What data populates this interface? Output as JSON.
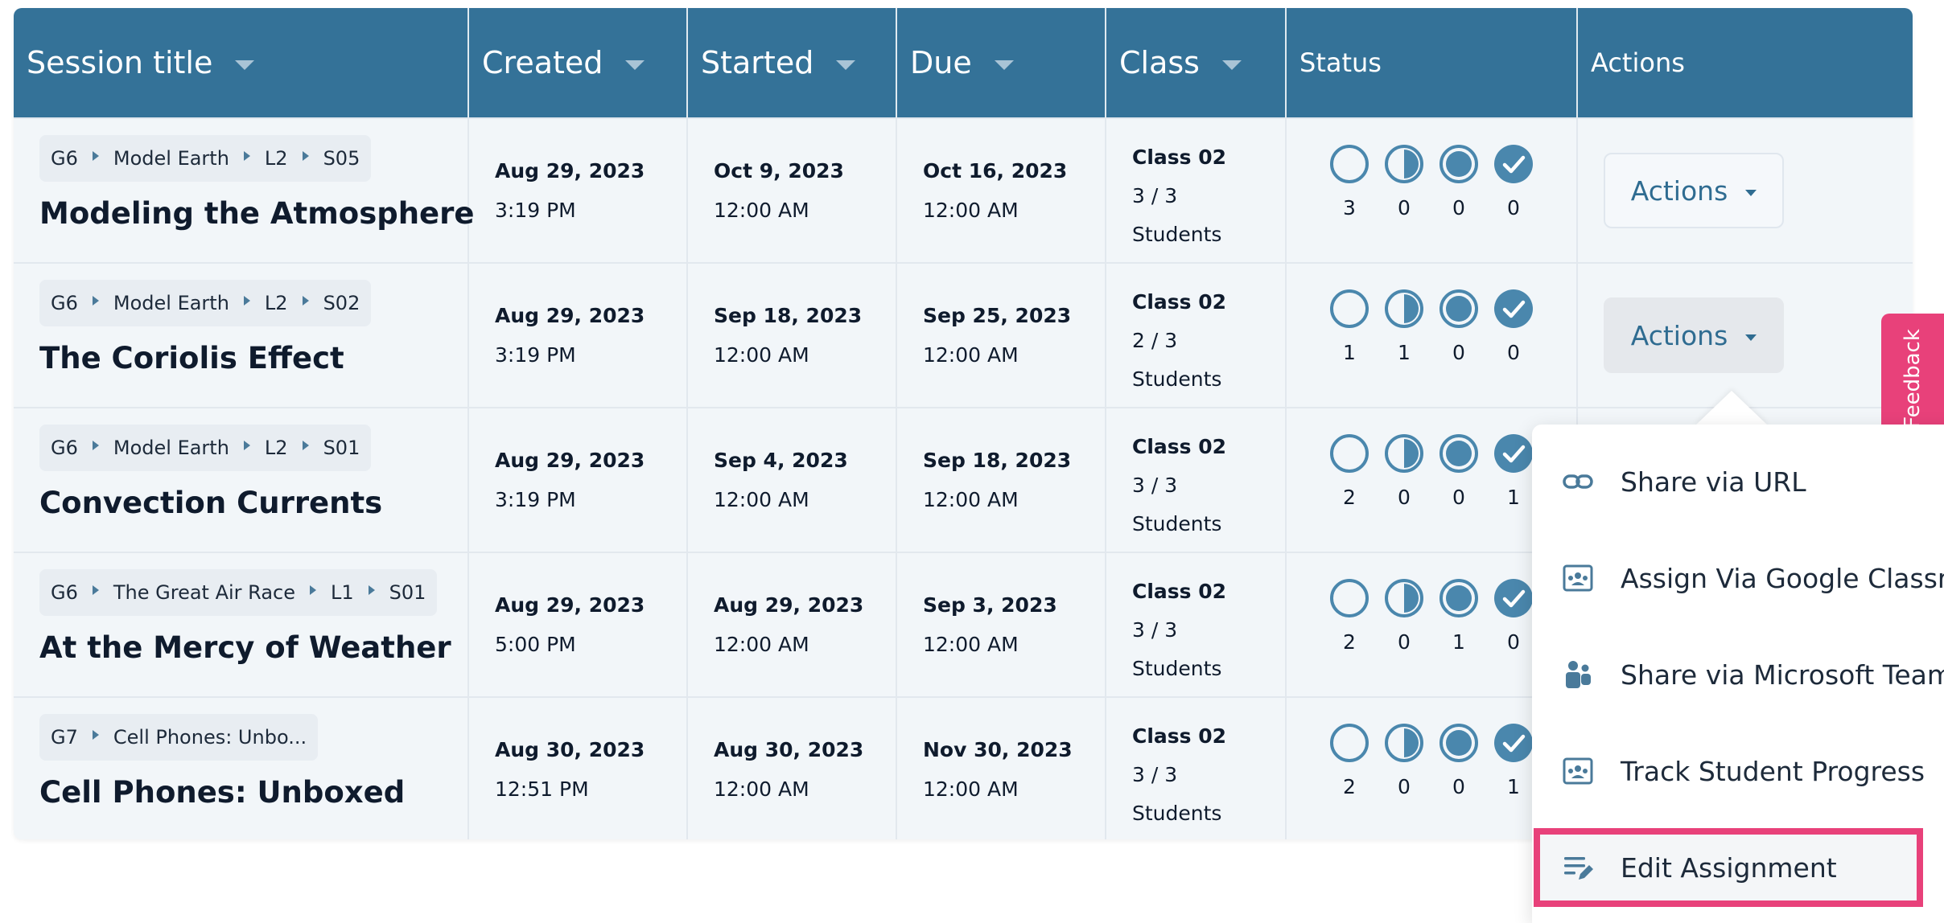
{
  "header": {
    "columns": [
      "Session title",
      "Created",
      "Started",
      "Due",
      "Class",
      "Status",
      "Actions"
    ]
  },
  "rows": [
    {
      "crumbs": [
        "G6",
        "Model Earth",
        "L2",
        "S05"
      ],
      "title": "Modeling the Atmosphere",
      "created_date": "Aug 29, 2023",
      "created_time": "3:19 PM",
      "started_date": "Oct 9, 2023",
      "started_time": "12:00 AM",
      "due_date": "Oct 16, 2023",
      "due_time": "12:00 AM",
      "class_name": "Class 02",
      "class_count": "3 / 3",
      "class_unit": "Students",
      "status_counts": [
        "3",
        "0",
        "0",
        "0"
      ],
      "actions_label": "Actions"
    },
    {
      "crumbs": [
        "G6",
        "Model Earth",
        "L2",
        "S02"
      ],
      "title": "The Coriolis Effect",
      "created_date": "Aug 29, 2023",
      "created_time": "3:19 PM",
      "started_date": "Sep 18, 2023",
      "started_time": "12:00 AM",
      "due_date": "Sep 25, 2023",
      "due_time": "12:00 AM",
      "class_name": "Class 02",
      "class_count": "2 / 3",
      "class_unit": "Students",
      "status_counts": [
        "1",
        "1",
        "0",
        "0"
      ],
      "actions_label": "Actions"
    },
    {
      "crumbs": [
        "G6",
        "Model Earth",
        "L2",
        "S01"
      ],
      "title": "Convection Currents",
      "created_date": "Aug 29, 2023",
      "created_time": "3:19 PM",
      "started_date": "Sep 4, 2023",
      "started_time": "12:00 AM",
      "due_date": "Sep 18, 2023",
      "due_time": "12:00 AM",
      "class_name": "Class 02",
      "class_count": "3 / 3",
      "class_unit": "Students",
      "status_counts": [
        "2",
        "0",
        "0",
        "1"
      ]
    },
    {
      "crumbs": [
        "G6",
        "The Great Air Race",
        "L1",
        "S01"
      ],
      "title": "At the Mercy of Weather",
      "created_date": "Aug 29, 2023",
      "created_time": "5:00 PM",
      "started_date": "Aug 29, 2023",
      "started_time": "12:00 AM",
      "due_date": "Sep 3, 2023",
      "due_time": "12:00 AM",
      "class_name": "Class 02",
      "class_count": "3 / 3",
      "class_unit": "Students",
      "status_counts": [
        "2",
        "0",
        "1",
        "0"
      ]
    },
    {
      "crumbs": [
        "G7",
        "Cell Phones: Unbo..."
      ],
      "title": "Cell Phones: Unboxed",
      "created_date": "Aug 30, 2023",
      "created_time": "12:51 PM",
      "started_date": "Aug 30, 2023",
      "started_time": "12:00 AM",
      "due_date": "Nov 30, 2023",
      "due_time": "12:00 AM",
      "class_name": "Class 02",
      "class_count": "3 / 3",
      "class_unit": "Students",
      "status_counts": [
        "2",
        "0",
        "0",
        "1"
      ]
    }
  ],
  "status_icons": [
    "circle-empty-icon",
    "circle-half-icon",
    "circle-filled-icon",
    "circle-check-icon"
  ],
  "dropdown": {
    "items": [
      {
        "label": "Share via URL",
        "icon": "link-icon"
      },
      {
        "label": "Assign Via Google Classroom",
        "icon": "google-classroom-icon"
      },
      {
        "label": "Share via Microsoft Teams",
        "icon": "microsoft-teams-icon"
      },
      {
        "label": "Track Student Progress",
        "icon": "track-progress-icon"
      },
      {
        "label": "Edit Assignment",
        "icon": "edit-list-icon"
      }
    ]
  },
  "feedback": {
    "label": "Feedback"
  },
  "colors": {
    "header_bg": "#347298",
    "accent": "#2f6c91",
    "highlight": "#e8417a",
    "row_bg": "#f2f6f9"
  }
}
